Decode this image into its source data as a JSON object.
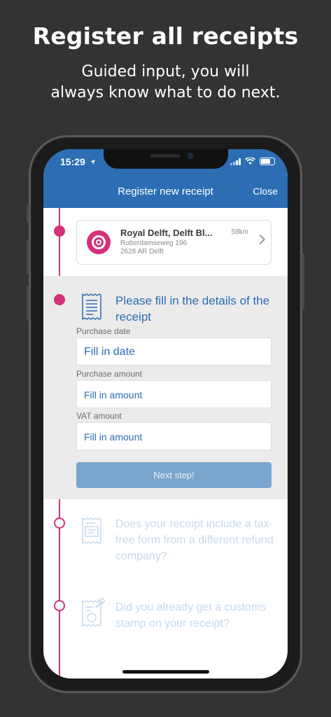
{
  "promo": {
    "title": "Register all receipts",
    "subtitle_line1": "Guided input, you will",
    "subtitle_line2": "always know what to do next."
  },
  "status_bar": {
    "time": "15:29",
    "icons": [
      "location-arrow-icon",
      "signal-icon",
      "wifi-icon",
      "battery-icon"
    ]
  },
  "nav": {
    "title": "Register new receipt",
    "close_label": "Close"
  },
  "store": {
    "name": "Royal Delft, Delft Bl...",
    "distance": "58km",
    "address_line1": "Rotterdamseweg 196",
    "address_line2": "2628 AR Delft"
  },
  "details": {
    "title": "Please fill in the details of the receipt",
    "purchase_date_label": "Purchase date",
    "purchase_date_placeholder": "Fill in date",
    "purchase_amount_label": "Purchase amount",
    "purchase_amount_placeholder": "Fill in amount",
    "vat_amount_label": "VAT amount",
    "vat_amount_placeholder": "Fill in amount",
    "next_button": "Next step!"
  },
  "steps": [
    {
      "text": "Does your receipt include a tax-free form from a different refund company?",
      "icon": "receipt-form-icon"
    },
    {
      "text": "Did you already get a customs stamp on your receipt?",
      "icon": "receipt-stamp-icon"
    }
  ],
  "colors": {
    "background": "#333333",
    "nav_blue": "#2c6db4",
    "accent_pink": "#d5317a",
    "button_disabled": "#7aa5cd",
    "inactive_text": "#c7d9ec"
  }
}
